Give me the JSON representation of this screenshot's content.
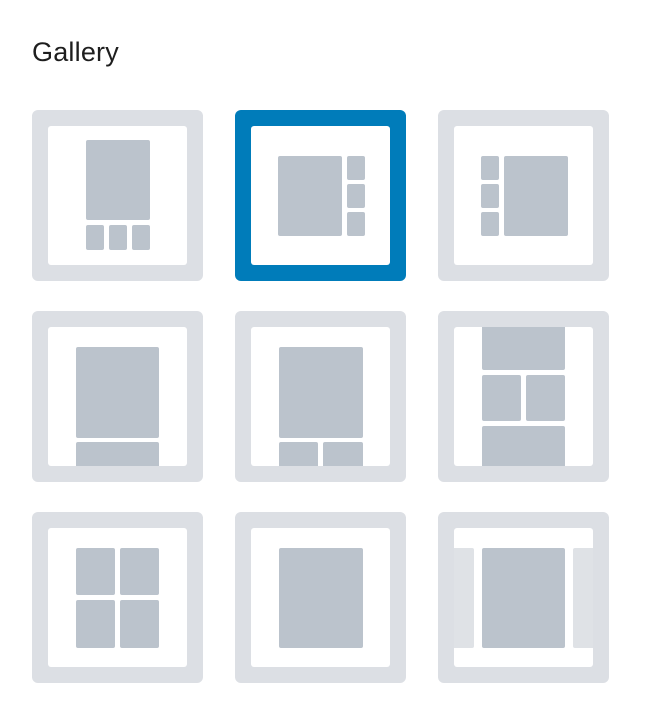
{
  "panel": {
    "title": "Gallery"
  },
  "selected_index": 1,
  "colors": {
    "tile_background": "#dcdfe4",
    "tile_selected_border": "#007cba",
    "thumbnail_block": "#bbc3cc",
    "thumbnail_faded_block": "#dfe2e6",
    "title_text": "#1e1e1e"
  },
  "layouts": [
    {
      "id": "large-top-three-small-bottom",
      "icon": "layout-large-top-three-below-icon"
    },
    {
      "id": "large-left-three-stacked-right",
      "icon": "layout-large-left-three-right-icon"
    },
    {
      "id": "three-stacked-left-large-right",
      "icon": "layout-three-left-large-right-icon"
    },
    {
      "id": "large-top-wide-bottom",
      "icon": "layout-large-top-wide-below-icon"
    },
    {
      "id": "large-top-two-bottom",
      "icon": "layout-large-top-two-below-icon"
    },
    {
      "id": "mosaic-wide-two-wide",
      "icon": "layout-mosaic-icon"
    },
    {
      "id": "two-by-two-grid",
      "icon": "layout-grid-2x2-icon"
    },
    {
      "id": "single-image",
      "icon": "layout-single-icon"
    },
    {
      "id": "carousel-peek",
      "icon": "layout-carousel-icon"
    }
  ]
}
